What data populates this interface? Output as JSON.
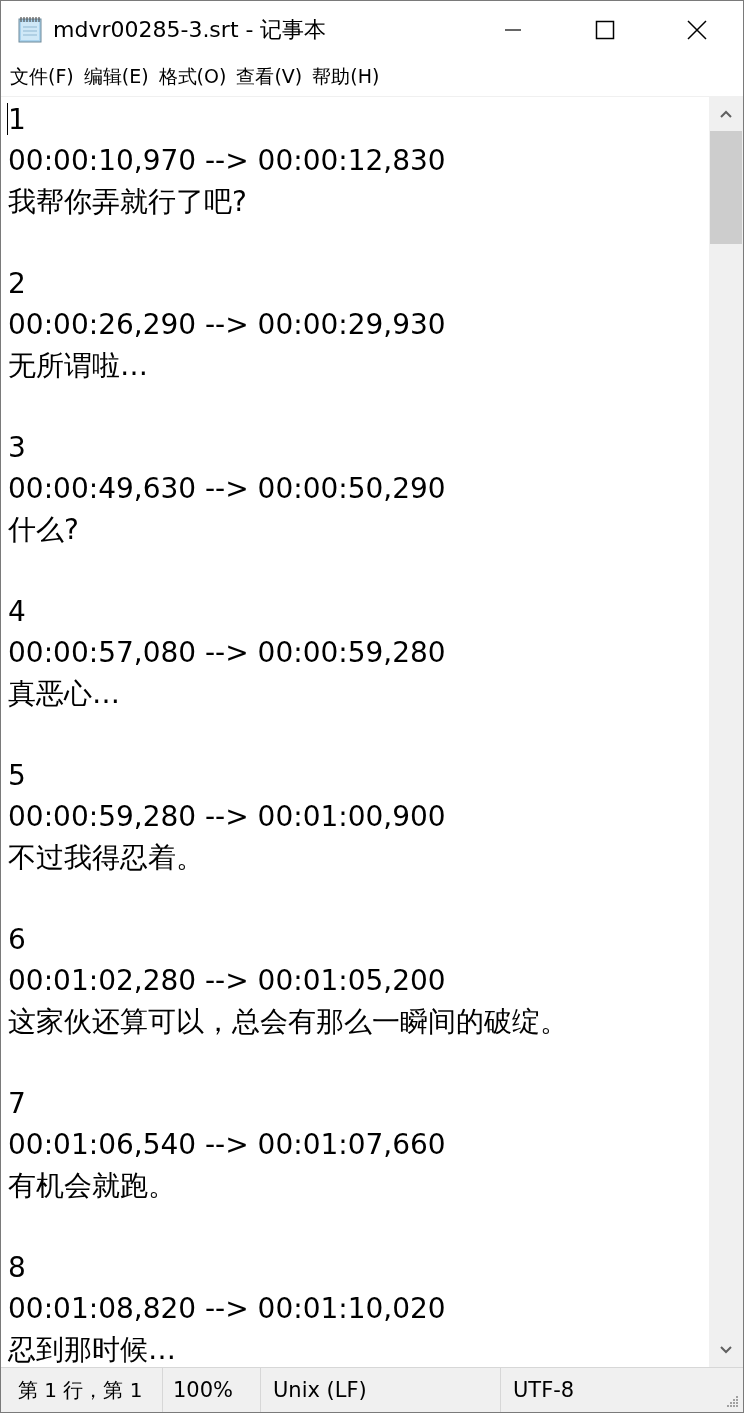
{
  "window": {
    "title": "mdvr00285-3.srt - 记事本"
  },
  "menu": [
    "文件(F)",
    "编辑(E)",
    "格式(O)",
    "查看(V)",
    "帮助(H)"
  ],
  "entries": [
    {
      "index": "1",
      "timing": "00:00:10,970 --> 00:00:12,830",
      "text": "我帮你弄就行了吧?"
    },
    {
      "index": "2",
      "timing": "00:00:26,290 --> 00:00:29,930",
      "text": "无所谓啦…"
    },
    {
      "index": "3",
      "timing": "00:00:49,630 --> 00:00:50,290",
      "text": "什么?"
    },
    {
      "index": "4",
      "timing": "00:00:57,080 --> 00:00:59,280",
      "text": "真恶心…"
    },
    {
      "index": "5",
      "timing": "00:00:59,280 --> 00:01:00,900",
      "text": "不过我得忍着。"
    },
    {
      "index": "6",
      "timing": "00:01:02,280 --> 00:01:05,200",
      "text": "这家伙还算可以，总会有那么一瞬间的破绽。"
    },
    {
      "index": "7",
      "timing": "00:01:06,540 --> 00:01:07,660",
      "text": "有机会就跑。"
    },
    {
      "index": "8",
      "timing": "00:01:08,820 --> 00:01:10,020",
      "text": "忍到那时候…"
    }
  ],
  "status_bar": {
    "position": "第 1 行，第 1",
    "zoom": "100%",
    "line_ending": "Unix (LF)",
    "encoding": "UTF-8"
  }
}
